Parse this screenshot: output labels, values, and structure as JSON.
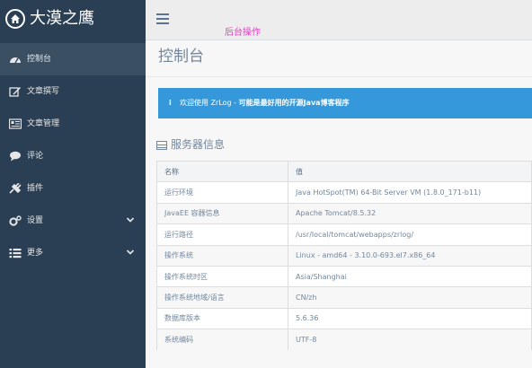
{
  "brand": {
    "title": "大漠之鹰",
    "icon": "home-icon"
  },
  "sidebar": {
    "items": [
      {
        "label": "控制台",
        "icon": "dashboard-icon",
        "active": true
      },
      {
        "label": "文章撰写",
        "icon": "edit-icon"
      },
      {
        "label": "文章管理",
        "icon": "article-list-icon"
      },
      {
        "label": "评论",
        "icon": "comment-icon"
      },
      {
        "label": "插件",
        "icon": "plugin-icon"
      },
      {
        "label": "设置",
        "icon": "cogs-icon",
        "expandable": true
      },
      {
        "label": "更多",
        "icon": "list-icon",
        "expandable": true
      }
    ]
  },
  "topbar": {
    "menu_icon": "hamburger-icon",
    "label": "后台操作"
  },
  "main": {
    "page_title": "控制台",
    "alert": {
      "icon": "info-icon",
      "prefix": "欢迎使用 ZrLog - ",
      "emphasis": "可能是最好用的开源Java博客程序"
    },
    "server_info": {
      "title": "服务器信息",
      "columns": [
        "名称",
        "值"
      ],
      "rows": [
        [
          "运行环境",
          "Java HotSpot(TM) 64-Bit Server VM (1.8.0_171-b11)"
        ],
        [
          "JavaEE 容器信息",
          "Apache Tomcat/8.5.32"
        ],
        [
          "运行路径",
          "/usr/local/tomcat/webapps/zrlog/"
        ],
        [
          "操作系统",
          "Linux - amd64 - 3.10.0-693.el7.x86_64"
        ],
        [
          "操作系统时区",
          "Asia/Shanghai"
        ],
        [
          "操作系统地域/语言",
          "CN/zh"
        ],
        [
          "数据库版本",
          "5.6.36"
        ],
        [
          "系统编码",
          "UTF-8"
        ]
      ]
    }
  },
  "colors": {
    "sidebar_bg": "#2a3f54",
    "active_accent": "#1abb9c",
    "alert_bg": "#3498db",
    "topbar_label": "#e040c0",
    "text_muted": "#73879c"
  }
}
